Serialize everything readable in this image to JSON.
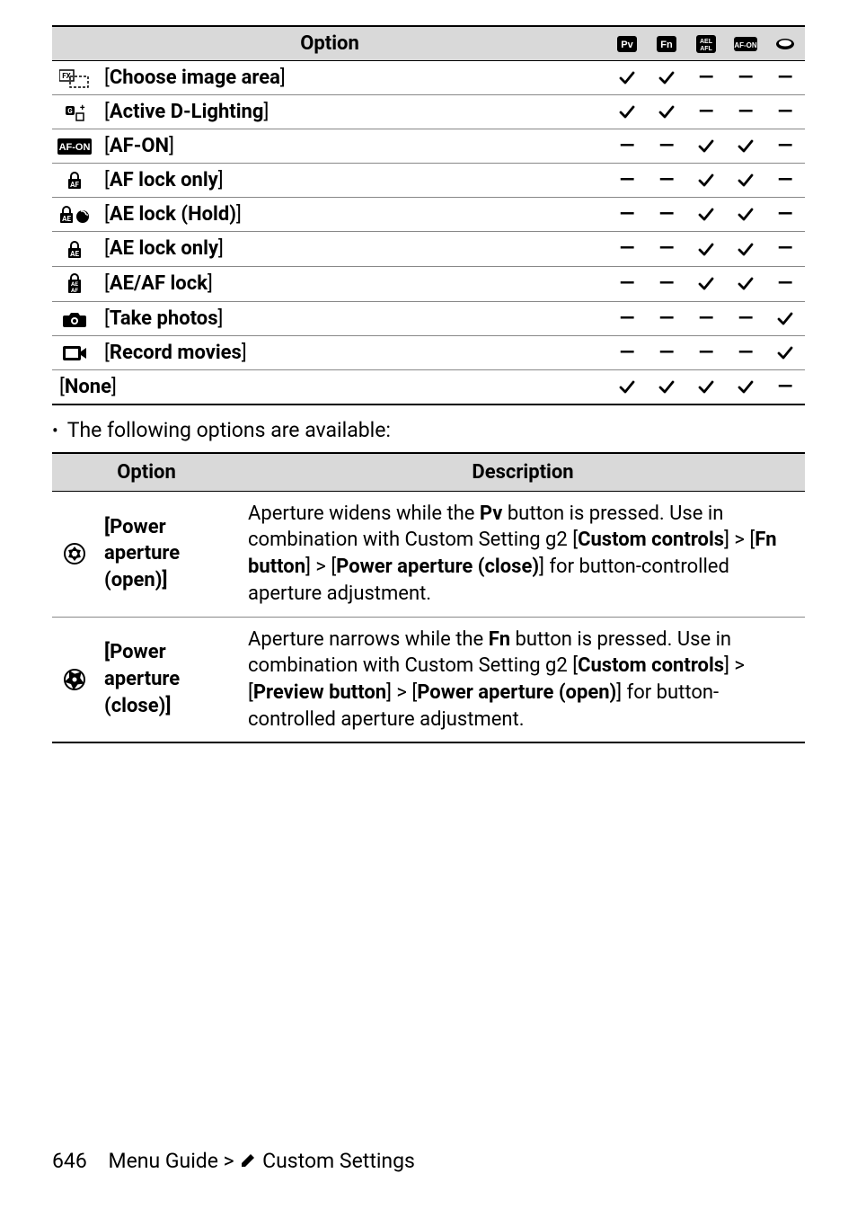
{
  "table1": {
    "header_option": "Option",
    "ctx_labels": [
      "Pv",
      "Fn",
      "AEL/AFL",
      "AF-ON",
      "●"
    ],
    "rows": [
      {
        "icon": "fx-frame",
        "label_pre": "[",
        "label_bold": "Choose image area",
        "label_post": "]",
        "cols": [
          "check",
          "check",
          "dash",
          "dash",
          "dash"
        ]
      },
      {
        "icon": "gj-light",
        "label_pre": "[",
        "label_bold": "Active D-Lighting",
        "label_post": "]",
        "cols": [
          "check",
          "check",
          "dash",
          "dash",
          "dash"
        ]
      },
      {
        "icon": "afon",
        "label_pre": "[",
        "label_bold": "AF-ON",
        "label_post": "]",
        "cols": [
          "dash",
          "dash",
          "check",
          "check",
          "dash"
        ]
      },
      {
        "icon": "af-lock",
        "label_pre": "[",
        "label_bold": "AF lock only",
        "label_post": "]",
        "cols": [
          "dash",
          "dash",
          "check",
          "check",
          "dash"
        ]
      },
      {
        "icon": "ae-hold",
        "label_pre": "[",
        "label_bold": "AE lock (Hold)",
        "label_post": "]",
        "cols": [
          "dash",
          "dash",
          "check",
          "check",
          "dash"
        ]
      },
      {
        "icon": "ae-lock",
        "label_pre": "[",
        "label_bold": "AE lock only",
        "label_post": "]",
        "cols": [
          "dash",
          "dash",
          "check",
          "check",
          "dash"
        ]
      },
      {
        "icon": "aeaf-lock",
        "label_pre": "[",
        "label_bold": "AE/AF lock",
        "label_post": "]",
        "cols": [
          "dash",
          "dash",
          "check",
          "check",
          "dash"
        ]
      },
      {
        "icon": "camera",
        "label_pre": "[",
        "label_bold": "Take photos",
        "label_post": "]",
        "cols": [
          "dash",
          "dash",
          "dash",
          "dash",
          "check"
        ]
      },
      {
        "icon": "movie",
        "label_pre": "[",
        "label_bold": "Record movies",
        "label_post": "]",
        "cols": [
          "dash",
          "dash",
          "dash",
          "dash",
          "check"
        ]
      }
    ],
    "none_row": {
      "label_pre": "[",
      "label_bold": "None",
      "label_post": "]",
      "cols": [
        "check",
        "check",
        "check",
        "check",
        "dash"
      ]
    }
  },
  "bullet_text": "The following options are available:",
  "table2": {
    "header_option": "Option",
    "header_desc": "Description",
    "rows": [
      {
        "icon": "aperture-open",
        "name_pre": "[",
        "name_bold": "Power aperture (open)",
        "name_post": "]",
        "desc_html": "Aperture widens while the <b>Pv</b> button is pressed. Use in combination with Custom Setting g2 [<b>Custom controls</b>] > [<b>Fn button</b>] > [<b>Power aperture (close)</b>] for button-controlled aperture adjustment."
      },
      {
        "icon": "aperture-close",
        "name_pre": "[",
        "name_bold": "Power aperture (close)",
        "name_post": "]",
        "desc_html": "Aperture narrows while the <b>Fn</b> button is pressed. Use in combination with Custom Setting g2 [<b>Custom controls</b>] > [<b>Preview button</b>] > [<b>Power aperture (open)</b>] for button-controlled aperture adjustment."
      }
    ]
  },
  "footer": {
    "page": "646",
    "path_before": "Menu Guide > ",
    "path_after": " Custom Settings"
  }
}
